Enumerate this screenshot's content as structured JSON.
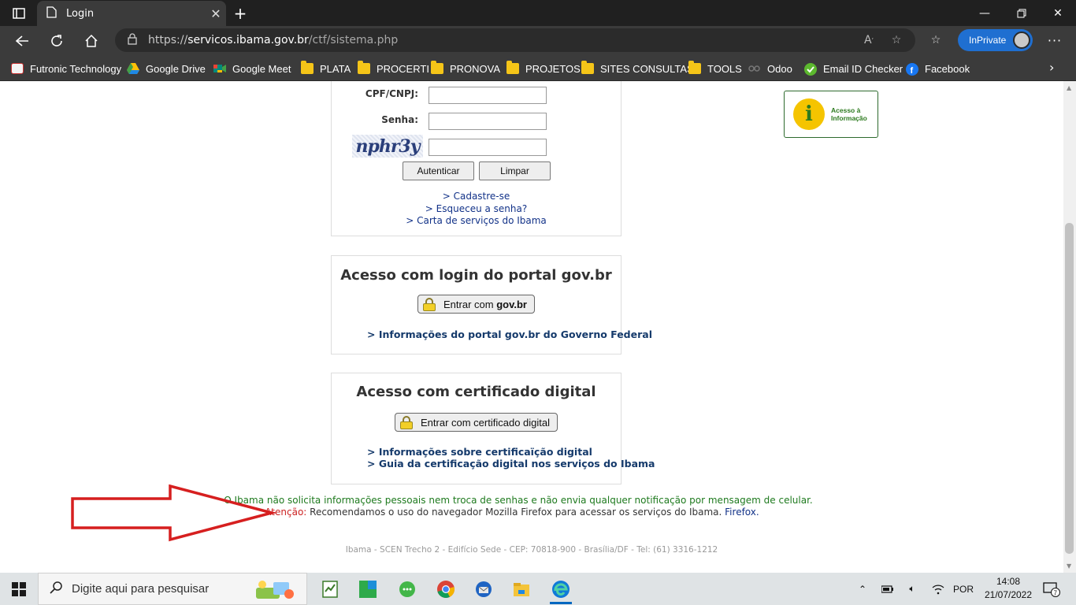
{
  "browser": {
    "tab_title": "Login",
    "url_scheme": "https://",
    "url_domain": "servicos.ibama.gov.br",
    "url_path": "/ctf/sistema.php",
    "inprivate_label": "InPrivate"
  },
  "bookmarks": [
    {
      "label": "Futronic Technology",
      "icon": "futronic-icon"
    },
    {
      "label": "Google Drive",
      "icon": "google-drive-icon"
    },
    {
      "label": "Google Meet",
      "icon": "google-meet-icon"
    },
    {
      "label": "PLATA",
      "icon": "folder-icon"
    },
    {
      "label": "PROCERTI",
      "icon": "folder-icon"
    },
    {
      "label": "PRONOVA",
      "icon": "folder-icon"
    },
    {
      "label": "PROJETOS",
      "icon": "folder-icon"
    },
    {
      "label": "SITES CONSULTAS",
      "icon": "folder-icon"
    },
    {
      "label": "TOOLS",
      "icon": "folder-icon"
    },
    {
      "label": "Odoo",
      "icon": "odoo-icon"
    },
    {
      "label": "Email ID Checker",
      "icon": "check-icon"
    },
    {
      "label": "Facebook",
      "icon": "facebook-icon"
    }
  ],
  "login": {
    "cpf_label": "CPF/CNPJ:",
    "senha_label": "Senha:",
    "captcha_text": "nphr3y",
    "auth_button": "Autenticar",
    "clear_button": "Limpar",
    "link_cadastro": "Cadastre-se",
    "link_senha": "Esqueceu a senha?",
    "link_carta": "Carta de serviços do Ibama",
    "link_prefix": ">"
  },
  "acesso_badge": {
    "line1": "Acesso à",
    "line2": "Informação",
    "glyph": "i"
  },
  "govbr": {
    "title": "Acesso com login do portal gov.br",
    "button_prefix": "Entrar com ",
    "button_bold": "gov.br",
    "info_link": "> Informações do portal gov.br do Governo Federal"
  },
  "cert": {
    "title": "Acesso com certificado digital",
    "button": "Entrar com certificado digital",
    "link1": "> Informações sobre certificaïção digital",
    "link2": "> Guia da certificação digital nos serviços do Ibama"
  },
  "notices": {
    "line1": "O Ibama não solicita informações pessoais nem troca de senhas e não envia qualquer notificação por mensagem de celular.",
    "warn_label": "Atenção:",
    "line2": " Recomendamos o uso do navegador Mozilla Firefox para acessar os serviços do Ibama. ",
    "firefox_link": "Firefox."
  },
  "footer": "Ibama - SCEN Trecho 2 - Edifício Sede - CEP: 70818-900 - Brasília/DF - Tel: (61) 3316-1212",
  "taskbar": {
    "search_placeholder": "Digite aqui para pesquisar",
    "language": "POR",
    "time": "14:08",
    "date": "21/07/2022",
    "notification_count": "7"
  },
  "colors": {
    "accent_blue": "#1f6fd1",
    "link_blue": "#123288",
    "notice_green": "#1e7a1e",
    "warn_red": "#cc2222",
    "arrow_red": "#d61f1f"
  }
}
